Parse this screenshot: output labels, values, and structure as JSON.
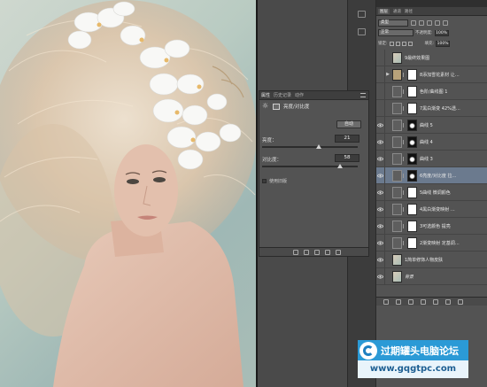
{
  "properties_panel": {
    "tabs": [
      "属性",
      "历史记录",
      "动作"
    ],
    "adjustment_title": "亮度/对比度",
    "auto_button": "自动",
    "brightness": {
      "label": "亮度：",
      "value": "21"
    },
    "contrast": {
      "label": "对比度：",
      "value": "58"
    },
    "use_legacy": "使用旧版"
  },
  "layers_panel": {
    "tabs": [
      "图层",
      "通道",
      "路径"
    ],
    "kind_label": "类型",
    "blend_mode": "正常",
    "opacity_label": "不透明度:",
    "opacity_value": "100%",
    "lock_label": "锁定:",
    "fill_label": "填充:",
    "fill_value": "100%",
    "layers": [
      {
        "name": "9最终效果图",
        "type": "pixel",
        "visible": false,
        "selected": false
      },
      {
        "name": "8添加雪花素材 让…",
        "type": "group",
        "visible": false,
        "selected": false
      },
      {
        "name": "色阶/曲线图 1",
        "type": "adjustment",
        "visible": false,
        "selected": false
      },
      {
        "name": "7黑白渐变 42%透…",
        "type": "adjustment",
        "visible": false,
        "selected": false
      },
      {
        "name": "曲线 5",
        "type": "adjustment",
        "visible": true,
        "selected": false
      },
      {
        "name": "曲线 4",
        "type": "adjustment",
        "visible": true,
        "selected": false
      },
      {
        "name": "曲线 3",
        "type": "adjustment",
        "visible": true,
        "selected": false
      },
      {
        "name": "6亮度/对比度  拉…",
        "type": "adjustment",
        "visible": true,
        "selected": true
      },
      {
        "name": "5曲线  微调颜色",
        "type": "adjustment",
        "visible": true,
        "selected": false
      },
      {
        "name": "4黑白渐变映射 …",
        "type": "adjustment",
        "visible": true,
        "selected": false
      },
      {
        "name": "3可选颜色  提亮",
        "type": "adjustment",
        "visible": true,
        "selected": false
      },
      {
        "name": "2渐变映射 定基调…",
        "type": "adjustment",
        "visible": true,
        "selected": false
      },
      {
        "name": "1简单修饰人物皮肤",
        "type": "pixel",
        "visible": true,
        "selected": false
      },
      {
        "name": "背景",
        "type": "pixel",
        "visible": true,
        "selected": false
      }
    ]
  },
  "watermark": {
    "title": "过期罐头电脑论坛",
    "url": "www.gqgtpc.com"
  }
}
